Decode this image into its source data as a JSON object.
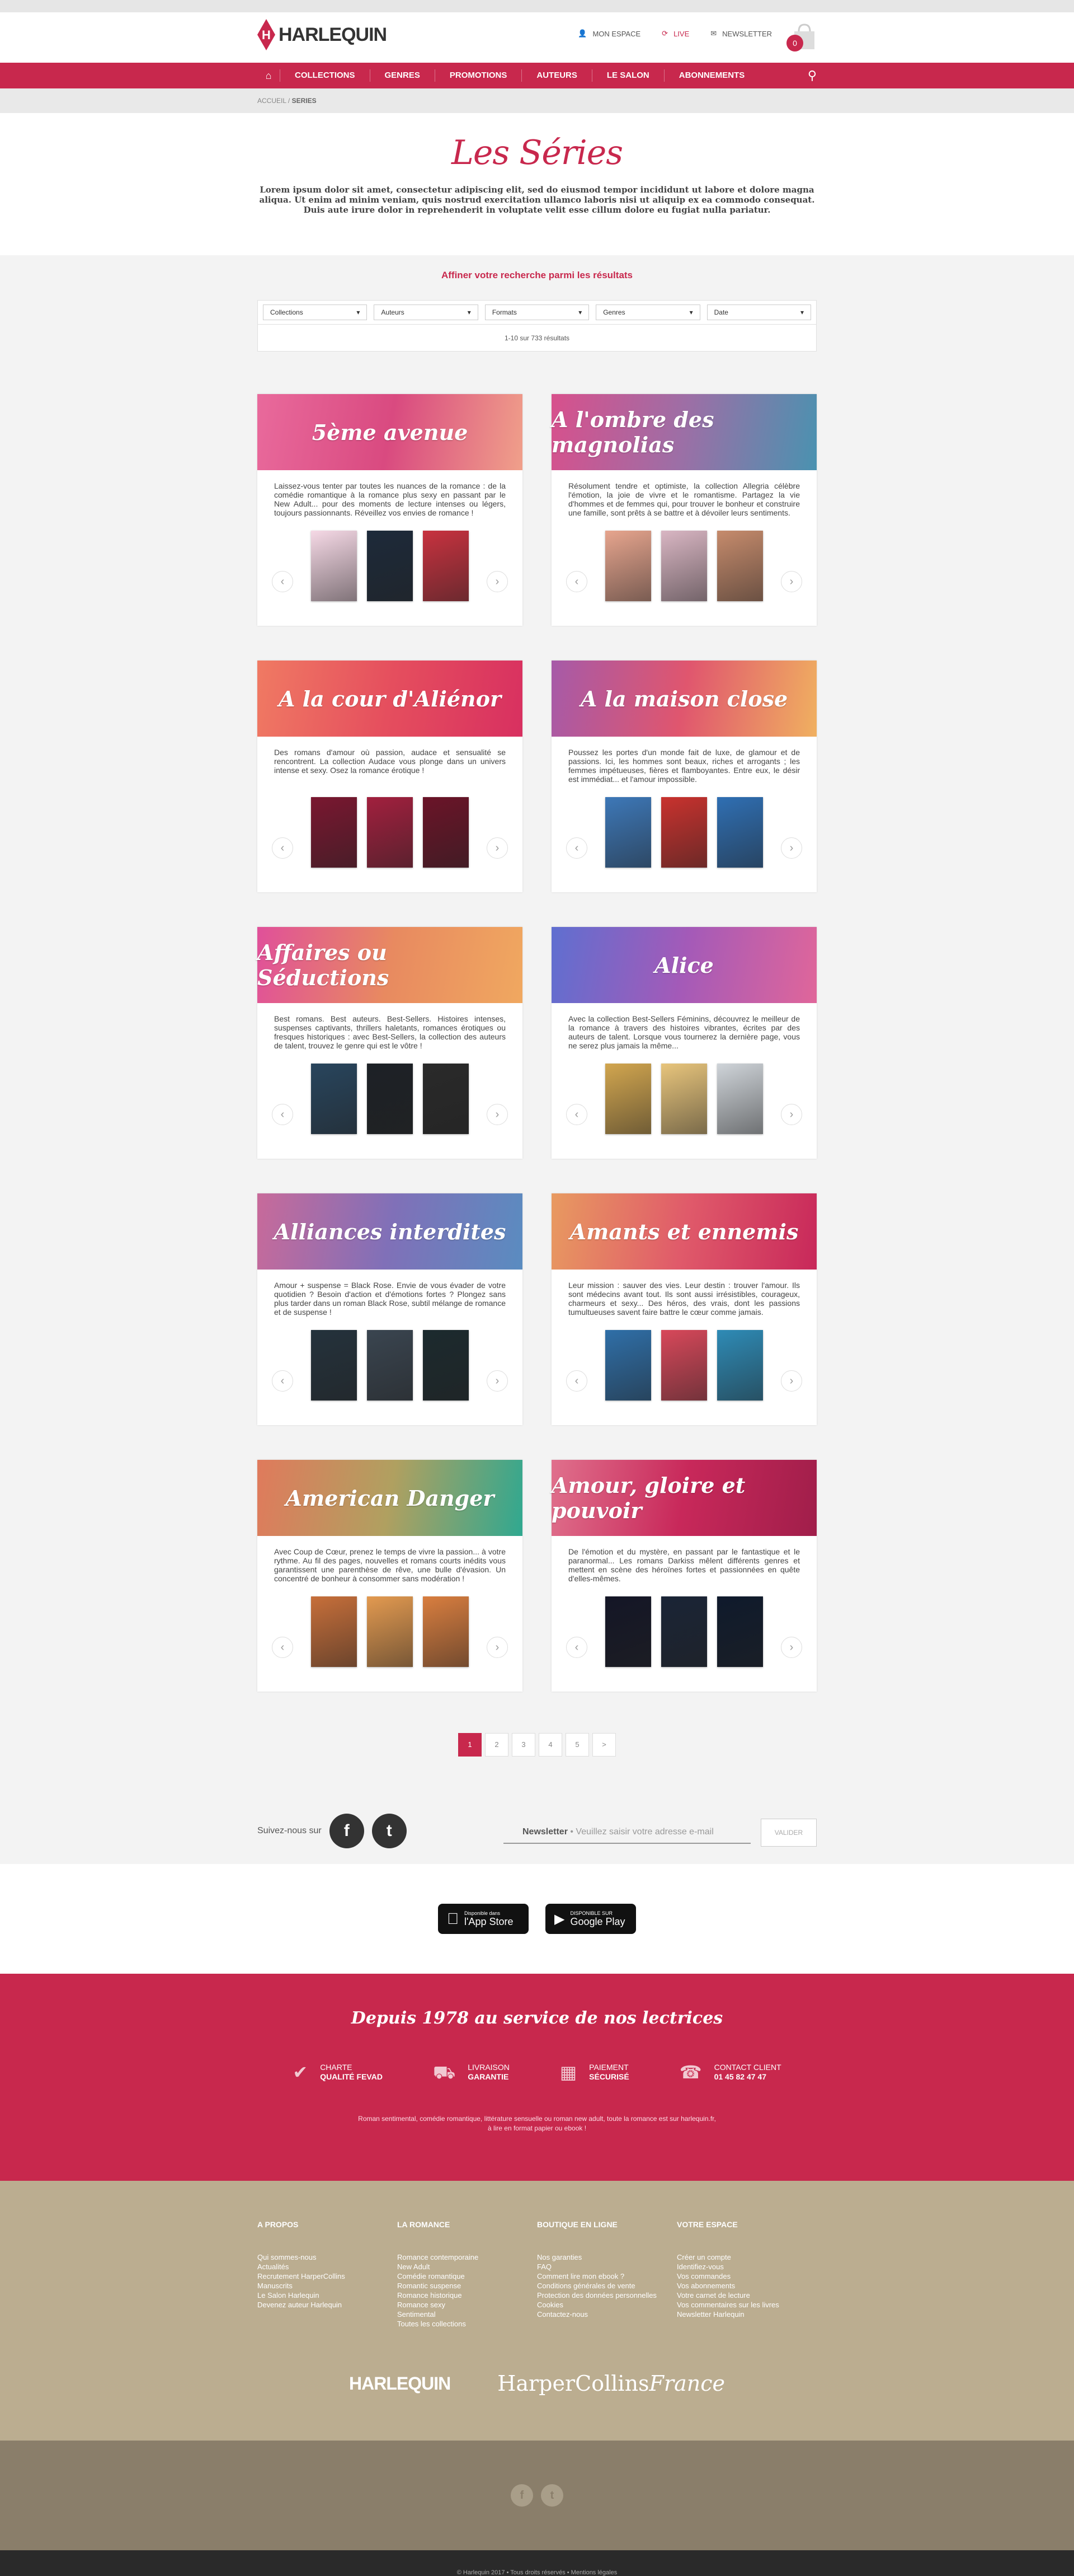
{
  "header": {
    "logo": "HARLEQUIN",
    "links": [
      {
        "icon": "user-icon",
        "label": "MON ESPACE"
      },
      {
        "icon": "live-icon",
        "label": "LIVE"
      },
      {
        "icon": "mail-icon",
        "label": "NEWSLETTER"
      }
    ],
    "cart_count": "0"
  },
  "nav": {
    "items": [
      "COLLECTIONS",
      "GENRES",
      "PROMOTIONS",
      "AUTEURS",
      "LE SALON",
      "ABONNEMENTS"
    ]
  },
  "breadcrumb": {
    "home": "ACCUEIL",
    "sep": "/",
    "current": "SERIES"
  },
  "intro": {
    "title": "Les Séries",
    "text": "Lorem ipsum dolor sit amet, consectetur adipiscing elit, sed do eiusmod tempor incididunt ut labore et dolore magna aliqua. Ut enim ad minim veniam, quis nostrud exercitation ullamco laboris nisi ut aliquip ex ea commodo consequat. Duis aute irure dolor in reprehenderit in voluptate velit esse cillum dolore eu fugiat nulla pariatur."
  },
  "refine": {
    "title": "Affiner votre recherche parmi les résultats"
  },
  "filters": [
    "Collections",
    "Auteurs",
    "Formats",
    "Genres",
    "Date"
  ],
  "results": "1-10 sur 733 résultats",
  "series": [
    {
      "title": "5ème avenue",
      "text": "Laissez-vous tenter par toutes les nuances de la romance : de la comédie romantique à la romance plus sexy en passant par le New Adult... pour des moments de lecture intenses ou légers, toujours passionnants. Réveillez vos envies de romance !",
      "grad": [
        "#e96a9c",
        "#d94a80",
        "#f0a08a"
      ],
      "books": [
        "#f6d9e6",
        "#1d2a3a",
        "#c8323f"
      ]
    },
    {
      "title": "A l'ombre des magnolias",
      "text": "Résolument tendre et optimiste, la collection Allegria célèbre l'émotion, la joie de vivre et le romantisme. Partagez la vie d'hommes et de femmes qui, pour trouver le bonheur et construire une famille, sont prêts à se battre et à dévoiler leurs sentiments.",
      "grad": [
        "#d8508c",
        "#9c6fa6",
        "#4a92b0"
      ],
      "books": [
        "#e7a58e",
        "#d9b6c3",
        "#c68b6c"
      ]
    },
    {
      "title": "A la cour d'Aliénor",
      "text": "Des romans d'amour où passion, audace et sensualité se rencontrent. La collection Audace vous plonge dans un univers intense et sexy. Osez la romance érotique !",
      "grad": [
        "#f07a63",
        "#e54e5e",
        "#d83060"
      ],
      "books": [
        "#7a1730",
        "#a2203e",
        "#6b1428"
      ]
    },
    {
      "title": "A la maison close",
      "text": "Poussez les portes d'un monde fait de luxe, de glamour et de passions. Ici, les hommes sont beaux, riches et arrogants ; les femmes impétueuses, fières et flamboyantes. Entre eux, le désir est immédiat... et l'amour impossible.",
      "grad": [
        "#a65aa8",
        "#e0566e",
        "#f0b060"
      ],
      "books": [
        "#3d78b8",
        "#c9322e",
        "#2f6fb3"
      ]
    },
    {
      "title": "Affaires ou Séductions",
      "text": "Best romans. Best auteurs. Best-Sellers. Histoires intenses, suspenses captivants, thrillers haletants, romances érotiques ou fresques historiques : avec Best-Sellers, la collection des auteurs de talent, trouvez le genre qui est le vôtre !",
      "grad": [
        "#e0509a",
        "#e88a60",
        "#f0a860"
      ],
      "books": [
        "#28455d",
        "#1d2126",
        "#2a2a2a"
      ]
    },
    {
      "title": "Alice",
      "text": "Avec la collection Best-Sellers Féminins, découvrez le meilleur de la romance à travers des histoires vibrantes, écrites par des auteurs de talent. Lorsque vous tournerez la dernière page, vous ne serez plus jamais la même...",
      "grad": [
        "#5f6fd0",
        "#a45ab8",
        "#e0669a"
      ],
      "books": [
        "#d2a64f",
        "#e8c57c",
        "#cfd4d9"
      ]
    },
    {
      "title": "Alliances interdites",
      "text": "Amour + suspense = Black Rose. Envie de vous évader de votre quotidien ? Besoin d'action et d'émotions fortes ? Plongez sans plus tarder dans un roman Black Rose, subtil mélange de romance et de suspense !",
      "grad": [
        "#c86a9a",
        "#8070b8",
        "#5a8cc0"
      ],
      "books": [
        "#24323c",
        "#3a4550",
        "#1c2a2e"
      ]
    },
    {
      "title": "Amants et ennemis",
      "text": "Leur mission : sauver des vies. Leur destin : trouver l'amour. Ils sont médecins avant tout. Ils sont aussi irrésistibles, courageux, charmeurs et sexy... Des héros, des vrais, dont les passions tumultueuses savent faire battre le cœur comme jamais.",
      "grad": [
        "#e89a60",
        "#e05a6a",
        "#c8285a"
      ],
      "books": [
        "#2f6fa8",
        "#d8485a",
        "#2e8bb6"
      ]
    },
    {
      "title": "American Danger",
      "text": "Avec Coup de Cœur, prenez le temps de vivre la passion... à votre rythme. Au fil des pages, nouvelles et romans courts inédits vous garantissent une parenthèse de rêve, une bulle d'évasion. Un concentré de bonheur à consommer sans modération !",
      "grad": [
        "#e07a5c",
        "#b0a060",
        "#30a890"
      ],
      "books": [
        "#c76f3a",
        "#e39a50",
        "#d97e3f"
      ]
    },
    {
      "title": "Amour, gloire et pouvoir",
      "text": "De l'émotion et du mystère, en passant par le fantastique et le paranormal... Les romans Darkiss mêlent différents genres et mettent en scène des héroïnes fortes et passionnées en quête d'elles-mêmes.",
      "grad": [
        "#e0708c",
        "#c8285a",
        "#a01e4a"
      ],
      "books": [
        "#141626",
        "#1a2436",
        "#0f1a2c"
      ]
    }
  ],
  "pagination": [
    "1",
    "2",
    "3",
    "4",
    "5",
    ">"
  ],
  "social": {
    "follow_label": "Suivez-nous",
    "follow_suffix": "sur",
    "facebook": "f",
    "twitter": "t"
  },
  "newsletter": {
    "label": "Newsletter",
    "placeholder": "• Veuillez saisir votre adresse e-mail",
    "button": "VALIDER"
  },
  "apps": {
    "appstore_small": "Disponible dans",
    "appstore_big": "l'App Store",
    "googleplay_small": "DISPONIBLE SUR",
    "googleplay_big": "Google Play"
  },
  "red_footer": {
    "title": "Depuis 1978 au service de nos lectrices",
    "features": [
      {
        "l1": "CHARTE",
        "l2": "QUALITÉ FEVAD"
      },
      {
        "l1": "LIVRAISON",
        "l2": "GARANTIE"
      },
      {
        "l1": "PAIEMENT",
        "l2": "SÉCURISÉ"
      },
      {
        "l1": "CONTACT CLIENT",
        "l2": "01 45 82 47 47"
      }
    ],
    "text1": "Roman sentimental, comédie romantique, littérature sensuelle ou roman new adult, toute la romance est sur harlequin.fr,",
    "text2": "à lire en format papier ou ebook !"
  },
  "footer": {
    "columns": [
      {
        "title": "A PROPOS",
        "links": [
          "Qui sommes-nous",
          "Actualités",
          "Recrutement HarperCollins",
          "Manuscrits",
          "Le Salon Harlequin",
          "Devenez auteur Harlequin"
        ]
      },
      {
        "title": "LA ROMANCE",
        "links": [
          "Romance contemporaine",
          "New Adult",
          "Comédie romantique",
          "Romantic suspense",
          "Romance historique",
          "Romance sexy",
          "Sentimental",
          "Toutes les collections"
        ]
      },
      {
        "title": "BOUTIQUE EN LIGNE",
        "links": [
          "Nos garanties",
          "FAQ",
          "Comment lire mon ebook ?",
          "Conditions générales de vente",
          "Protection des données personnelles",
          "Cookies",
          "Contactez-nous"
        ]
      },
      {
        "title": "VOTRE ESPACE",
        "links": [
          "Créer un compte",
          "Identifiez-vous",
          "Vos commandes",
          "Vos abonnements",
          "Votre carnet de lecture",
          "Vos commentaires sur les livres",
          "Newsletter Harlequin"
        ]
      }
    ],
    "brand1": "HARLEQUIN",
    "brand2a": "HarperCollins",
    "brand2b": "France",
    "copyright": "© Harlequin 2017 • Tous droits réservés • Mentions légales"
  }
}
